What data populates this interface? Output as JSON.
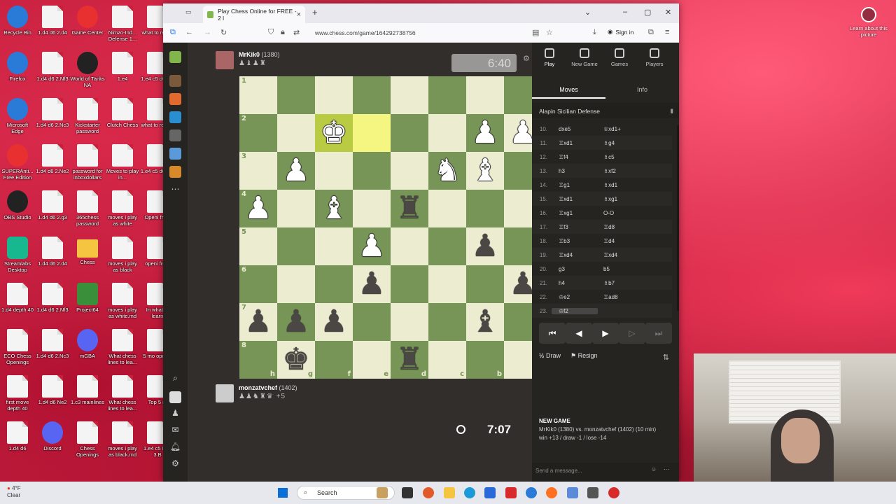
{
  "desktop": {
    "icons": [
      {
        "label": "Recycle Bin",
        "kind": "app"
      },
      {
        "label": "1.d4 d6 2.d4",
        "kind": "doc"
      },
      {
        "label": "Game Center",
        "kind": "red"
      },
      {
        "label": "Nimzo-Ind... Defense 1...",
        "kind": "doc"
      },
      {
        "label": "what to recen",
        "kind": "doc"
      },
      {
        "label": "Firefox",
        "kind": "app"
      },
      {
        "label": "1.d4 d6 2.Nf3",
        "kind": "doc"
      },
      {
        "label": "World of Tanks NA",
        "kind": "dark"
      },
      {
        "label": "1.e4",
        "kind": "doc"
      },
      {
        "label": "1.e4 c5 d6 3.d",
        "kind": "doc"
      },
      {
        "label": "Microsoft Edge",
        "kind": "app"
      },
      {
        "label": "1.d4 d6 2.Nc3",
        "kind": "doc"
      },
      {
        "label": "Kickstarter password",
        "kind": "doc"
      },
      {
        "label": "Clutch Chess",
        "kind": "doc"
      },
      {
        "label": "what to recent",
        "kind": "doc"
      },
      {
        "label": "SUPERAnti... Free Edition",
        "kind": "red"
      },
      {
        "label": "1.d4 d6 2.Ne2",
        "kind": "doc"
      },
      {
        "label": "password for inboxdollars",
        "kind": "doc"
      },
      {
        "label": "Moves to play in...",
        "kind": "doc"
      },
      {
        "label": "1.e4 c5 d6 3.B",
        "kind": "doc"
      },
      {
        "label": "OBS Studio",
        "kind": "dark"
      },
      {
        "label": "1.d4 d6 2.g3",
        "kind": "doc"
      },
      {
        "label": "365chess password",
        "kind": "doc"
      },
      {
        "label": "moves i play as white",
        "kind": "doc"
      },
      {
        "label": "Openi from",
        "kind": "doc"
      },
      {
        "label": "Streamlabs Desktop",
        "kind": "teal"
      },
      {
        "label": "1.d4 d6 2.d4",
        "kind": "doc"
      },
      {
        "label": "Chess",
        "kind": "folder"
      },
      {
        "label": "moves i play as black",
        "kind": "doc"
      },
      {
        "label": "openi from",
        "kind": "doc"
      },
      {
        "label": "1.d4 depth 40",
        "kind": "doc"
      },
      {
        "label": "1.d4 d6 2.Nf3",
        "kind": "doc"
      },
      {
        "label": "Project64",
        "kind": "green"
      },
      {
        "label": "moves i play as white.md",
        "kind": "doc"
      },
      {
        "label": "In what to learn",
        "kind": "doc"
      },
      {
        "label": "ECO Chess Openings",
        "kind": "doc"
      },
      {
        "label": "1.d4 d6 2.Nc3",
        "kind": "doc"
      },
      {
        "label": "mGBA",
        "kind": "purple"
      },
      {
        "label": "What chess lines to lea...",
        "kind": "doc"
      },
      {
        "label": "5 mo openin",
        "kind": "doc"
      },
      {
        "label": "first move depth 40",
        "kind": "doc"
      },
      {
        "label": "1.d4 d6 Ne2",
        "kind": "doc"
      },
      {
        "label": "1.c3 mainlines",
        "kind": "doc"
      },
      {
        "label": "What chess lines to lea...",
        "kind": "doc"
      },
      {
        "label": "Top 5 m",
        "kind": "doc"
      },
      {
        "label": "1.d4 d6",
        "kind": "doc"
      },
      {
        "label": "Discord",
        "kind": "purple"
      },
      {
        "label": "Chess Openings",
        "kind": "doc"
      },
      {
        "label": "moves i play as black.md",
        "kind": "doc"
      },
      {
        "label": "1.e4 c5 Nc6 3.B",
        "kind": "doc"
      }
    ],
    "lens_label": "Learn about this picture"
  },
  "browser": {
    "tab_title": "Play Chess Online for FREE - 2 l",
    "url": "www.chess.com/game/164292738756",
    "signin": "Sign in"
  },
  "game": {
    "top_player": {
      "name": "MrKik0",
      "rating": "(1380)",
      "clock": "6:40"
    },
    "bottom_player": {
      "name": "monzatvchef",
      "rating": "(1402)",
      "clock": "7:07",
      "material": "+5"
    },
    "board": [
      [
        "",
        "",
        "",
        "",
        "",
        "",
        "",
        ""
      ],
      [
        "",
        "",
        "wK",
        "",
        "",
        "",
        "wP",
        "wP"
      ],
      [
        "",
        "wP",
        "",
        "",
        "",
        "wN",
        "wB",
        ""
      ],
      [
        "wP",
        "",
        "wB",
        "",
        "bR",
        "",
        "",
        ""
      ],
      [
        "",
        "",
        "",
        "wP",
        "",
        "",
        "bP",
        ""
      ],
      [
        "",
        "",
        "",
        "bP",
        "",
        "",
        "",
        "bP"
      ],
      [
        "bP",
        "bP",
        "bP",
        "",
        "",
        "",
        "bB",
        ""
      ],
      [
        "",
        "bK",
        "",
        "",
        "bR",
        "",
        "",
        ""
      ]
    ],
    "ranks": [
      "1",
      "2",
      "3",
      "4",
      "5",
      "6",
      "7",
      "8"
    ],
    "files": [
      "h",
      "g",
      "f",
      "e",
      "d",
      "c",
      "b",
      "a"
    ],
    "highlight": [
      [
        1,
        2
      ],
      [
        1,
        3
      ]
    ]
  },
  "panel": {
    "nav": [
      {
        "label": "Play",
        "active": true
      },
      {
        "label": "New Game",
        "active": false
      },
      {
        "label": "Games",
        "active": false
      },
      {
        "label": "Players",
        "active": false
      }
    ],
    "tabs": [
      "Moves",
      "Info"
    ],
    "opening": "Alapin Sicilian Defense",
    "moves": [
      {
        "n": "10.",
        "w": "dxe5",
        "b": "♕xd1+"
      },
      {
        "n": "11.",
        "w": "♖xd1",
        "b": "♗g4"
      },
      {
        "n": "12.",
        "w": "♖f4",
        "b": "♗c5"
      },
      {
        "n": "13.",
        "w": "h3",
        "b": "♗xf2"
      },
      {
        "n": "14.",
        "w": "♖g1",
        "b": "♗xd1"
      },
      {
        "n": "15.",
        "w": "♖xd1",
        "b": "♗xg1"
      },
      {
        "n": "16.",
        "w": "♖xg1",
        "b": "O-O"
      },
      {
        "n": "17.",
        "w": "♖f3",
        "b": "♖d8"
      },
      {
        "n": "18.",
        "w": "♖b3",
        "b": "♖d4"
      },
      {
        "n": "19.",
        "w": "♖xd4",
        "b": "♖xd4"
      },
      {
        "n": "20.",
        "w": "g3",
        "b": "b5"
      },
      {
        "n": "21.",
        "w": "h4",
        "b": "♗b7"
      },
      {
        "n": "22.",
        "w": "♔e2",
        "b": "♖ad8"
      },
      {
        "n": "23.",
        "w": "♔f2",
        "b": ""
      }
    ],
    "draw": "Draw",
    "resign": "Resign",
    "new_game_title": "NEW GAME",
    "new_game_line": "MrKik0 (1380) vs. monzatvchef (1402) (10 min)",
    "new_game_stats": "win +13 / draw -1 / lose -14",
    "message_placeholder": "Send a message..."
  },
  "taskbar": {
    "weather_temp": "4°F",
    "weather_desc": "Clear",
    "search": "Search"
  }
}
